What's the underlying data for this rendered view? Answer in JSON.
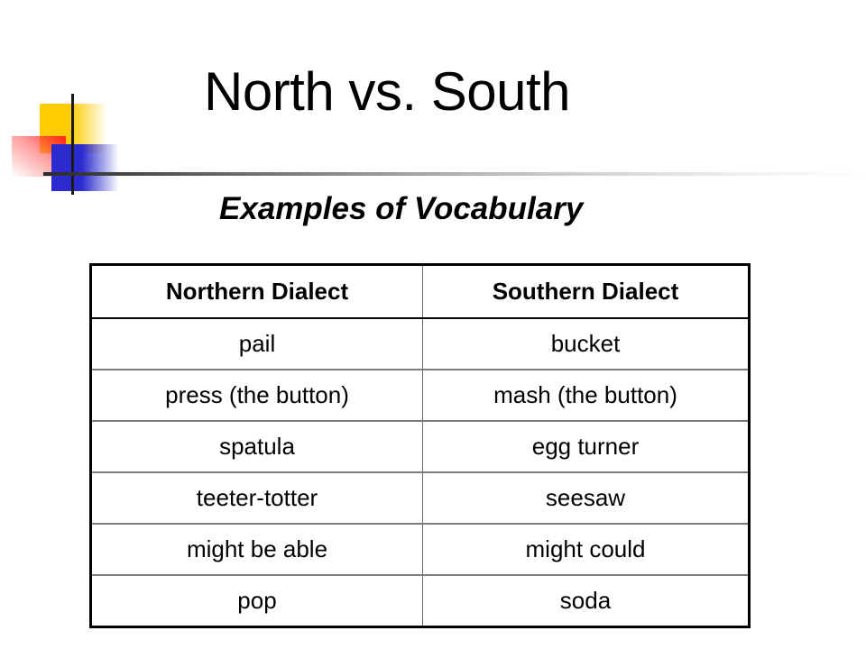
{
  "slide": {
    "title": "North vs. South",
    "subtitle": "Examples of Vocabulary",
    "decoration": {
      "colors": {
        "yellow": "#ffcc00",
        "red": "#ff2020",
        "blue": "#2b2bd0",
        "line": "#1a1a1a"
      }
    }
  },
  "table": {
    "headers": [
      "Northern Dialect",
      "Southern Dialect"
    ],
    "rows": [
      [
        "pail",
        "bucket"
      ],
      [
        "press (the button)",
        "mash (the button)"
      ],
      [
        "spatula",
        "egg turner"
      ],
      [
        "teeter-totter",
        "seesaw"
      ],
      [
        "might be able",
        "might could"
      ],
      [
        "pop",
        "soda"
      ]
    ]
  }
}
